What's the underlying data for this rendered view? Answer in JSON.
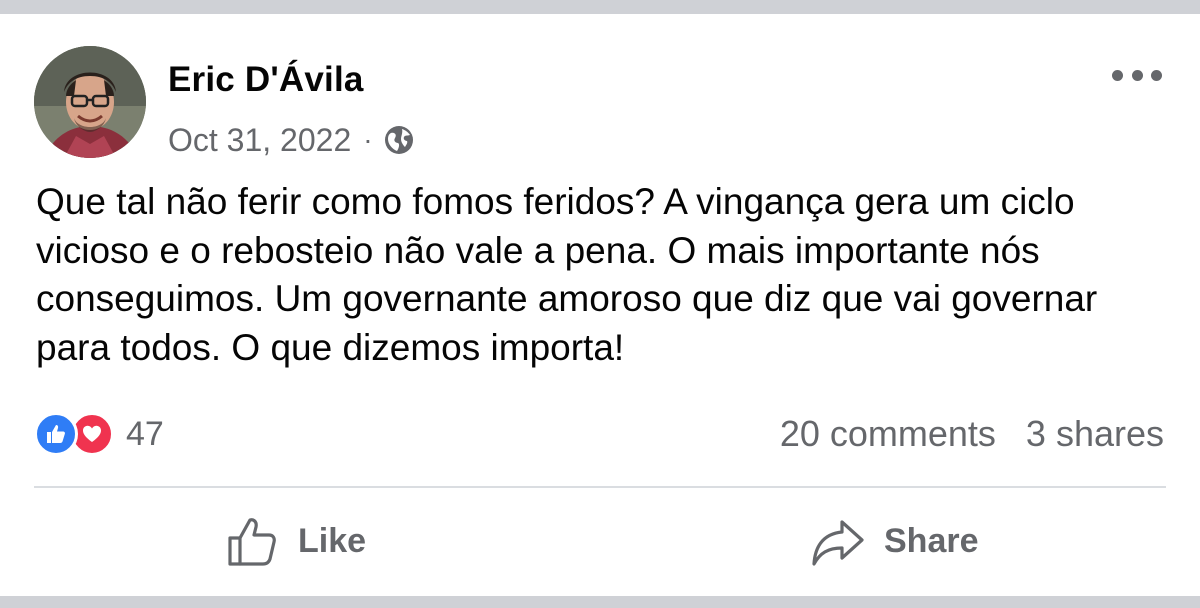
{
  "post": {
    "author": "Eric D'Ávila",
    "date": "Oct 31, 2022",
    "separator": "·",
    "privacy_icon": "globe-icon",
    "text": "Que tal não ferir como fomos feridos? A vingança gera um ciclo vicioso e o rebosteio não vale a pena. O mais importante nós conseguimos. Um governante amoroso que diz que vai governar para todos. O que dizemos importa!"
  },
  "reactions": {
    "types": [
      "like",
      "love"
    ],
    "count": "47"
  },
  "stats": {
    "comments": "20 comments",
    "shares": "3 shares"
  },
  "actions": {
    "like_label": "Like",
    "share_label": "Share"
  },
  "colors": {
    "text_primary": "#050505",
    "text_secondary": "#65676b",
    "like_blue": "#2f7df6",
    "love_red": "#f0334f",
    "divider": "#dadde1",
    "frame_gray": "#cfd1d6"
  }
}
